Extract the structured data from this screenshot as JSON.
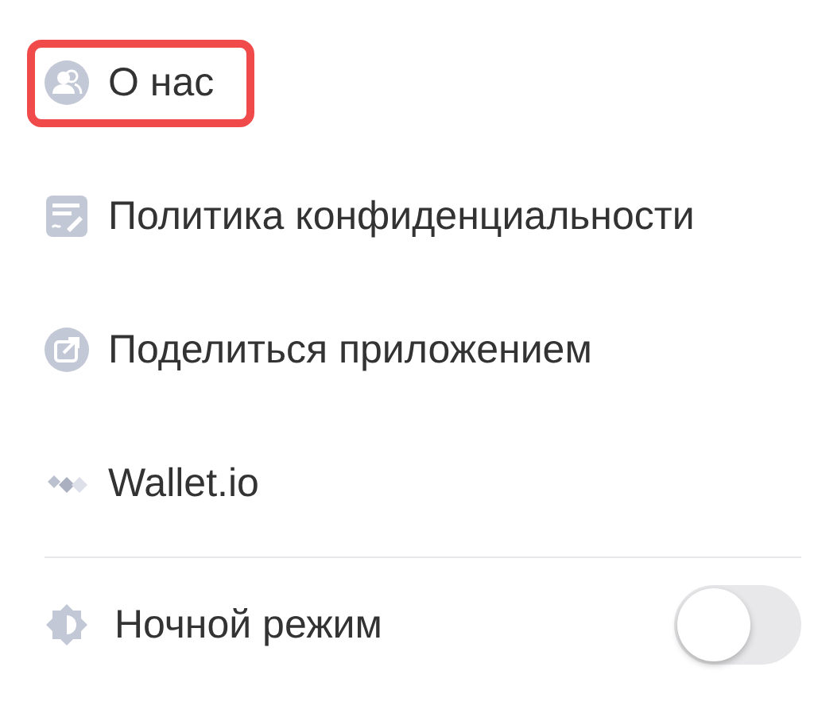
{
  "menu": [
    {
      "label": "О нас",
      "kind": "people",
      "highlighted": true
    },
    {
      "label": "Политика конфиденциальности",
      "kind": "document",
      "highlighted": false
    },
    {
      "label": "Поделиться приложением",
      "kind": "share",
      "highlighted": false
    },
    {
      "label": "Wallet.io",
      "kind": "logo",
      "highlighted": false
    }
  ],
  "night_mode": {
    "label": "Ночной режим",
    "on": false
  }
}
